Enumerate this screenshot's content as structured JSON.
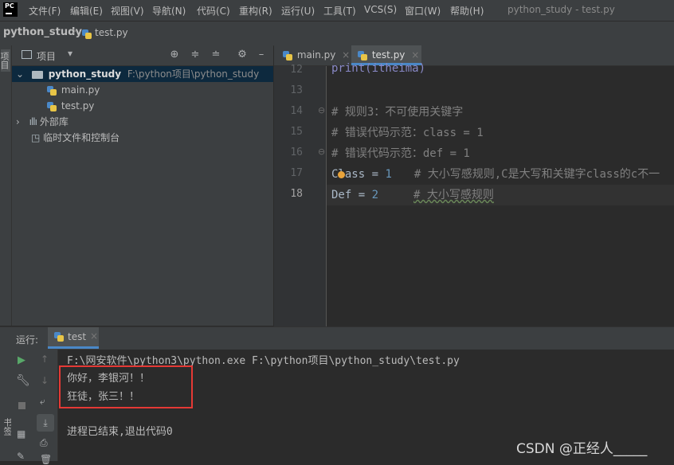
{
  "app": {
    "logo_text": "PC",
    "window_title": "python_study - test.py"
  },
  "menu": [
    "文件(F)",
    "编辑(E)",
    "视图(V)",
    "导航(N)",
    "代码(C)",
    "重构(R)",
    "运行(U)",
    "工具(T)",
    "VCS(S)",
    "窗口(W)",
    "帮助(H)"
  ],
  "breadcrumb": {
    "project": "python_study",
    "file": "test.py"
  },
  "left_strip": {
    "project_label": "项目",
    "bookmarks_label": "书签"
  },
  "project_panel": {
    "title": "项目",
    "root": {
      "name": "python_study",
      "path": "F:\\python项目\\python_study"
    },
    "files": [
      "main.py",
      "test.py"
    ],
    "external_libs": "外部库",
    "scratches": "临时文件和控制台"
  },
  "tabs": [
    {
      "label": "main.py",
      "active": false
    },
    {
      "label": "test.py",
      "active": true
    }
  ],
  "editor": {
    "lines": [
      {
        "num": "12",
        "text": "print(itheima)"
      },
      {
        "num": "13",
        "text": ""
      },
      {
        "num": "14",
        "text": "# 规则3：不可使用关键字"
      },
      {
        "num": "15",
        "text": "# 错误代码示范：class = 1"
      },
      {
        "num": "16",
        "text": "# 错误代码示范：def = 1"
      },
      {
        "num": "17",
        "name_part": "Class",
        "op": " = ",
        "value": "1",
        "comment": "# 大小写感规则,C是大写和关键字class的c不一"
      },
      {
        "num": "18",
        "name_part": "Def",
        "op": " = ",
        "value": "2",
        "comment": "# 大小写感规则"
      }
    ]
  },
  "run_panel": {
    "label": "运行:",
    "tab": "test",
    "command": "F:\\网安软件\\python3\\python.exe F:\\python项目\\python_study\\test.py",
    "output": [
      "你好，李银河！！",
      "狂徒，张三！！"
    ],
    "exit": "进程已结束,退出代码0"
  },
  "watermark": "CSDN @正经人_____",
  "colors": {
    "accent": "#4a88c7",
    "highlight_box": "#e53935",
    "comment": "#808080",
    "number": "#6897bb"
  }
}
